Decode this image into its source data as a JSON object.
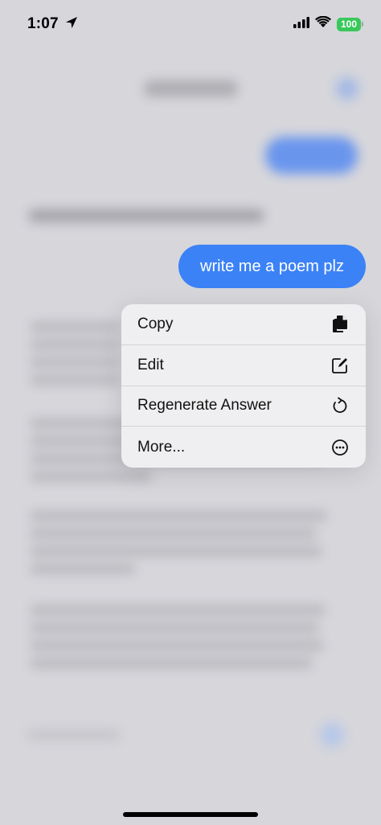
{
  "status_bar": {
    "time": "1:07",
    "battery": "100",
    "icons": [
      "location-arrow-icon",
      "cellular-signal-icon",
      "wifi-icon",
      "battery-icon"
    ],
    "battery_color": "#38c85a"
  },
  "message": {
    "text": "write me a poem plz",
    "bubble_color": "#3b82f6"
  },
  "context_menu": {
    "items": [
      {
        "label": "Copy",
        "icon": "copy-icon"
      },
      {
        "label": "Edit",
        "icon": "edit-icon"
      },
      {
        "label": "Regenerate Answer",
        "icon": "regenerate-icon"
      },
      {
        "label": "More...",
        "icon": "more-icon"
      }
    ]
  }
}
